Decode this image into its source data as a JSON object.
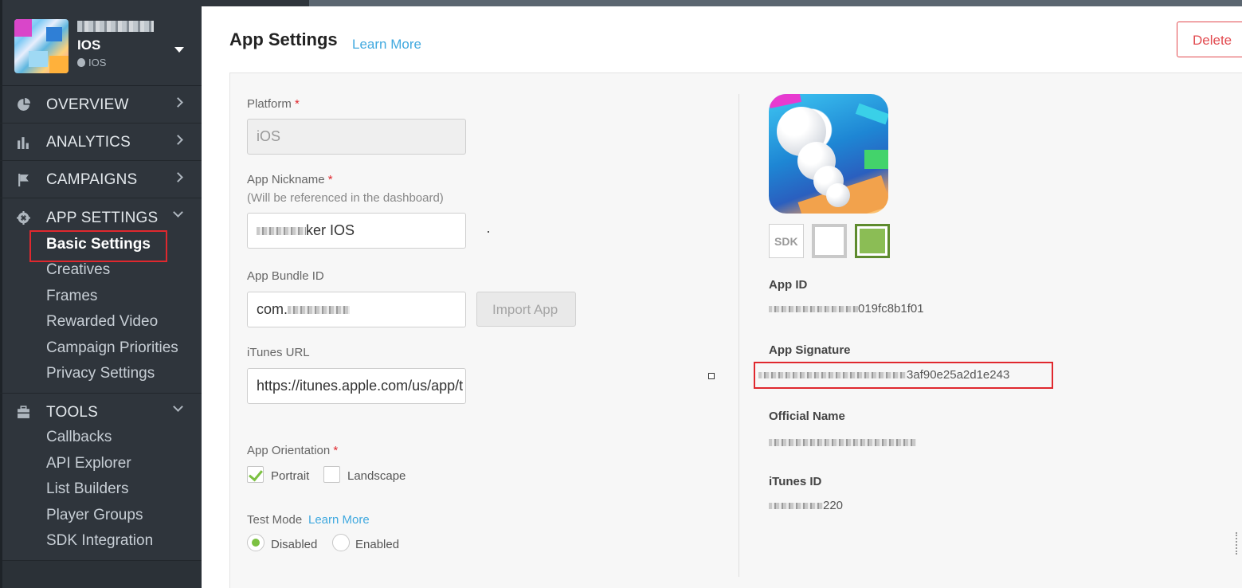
{
  "sidebar": {
    "app_name": "IOS",
    "app_platform": "IOS",
    "nav": [
      {
        "label": "OVERVIEW",
        "icon": "pie-chart-icon"
      },
      {
        "label": "ANALYTICS",
        "icon": "bar-chart-icon"
      },
      {
        "label": "CAMPAIGNS",
        "icon": "flag-icon"
      },
      {
        "label": "APP SETTINGS",
        "icon": "gear-icon"
      }
    ],
    "app_settings_items": [
      "Basic Settings",
      "Creatives",
      "Frames",
      "Rewarded Video",
      "Campaign Priorities",
      "Privacy Settings"
    ],
    "tools": {
      "label": "TOOLS",
      "icon": "toolbox-icon"
    },
    "tools_items": [
      "Callbacks",
      "API Explorer",
      "List Builders",
      "Player Groups",
      "SDK Integration"
    ]
  },
  "header": {
    "title": "App Settings",
    "learn_more": "Learn More",
    "delete_label": "Delete"
  },
  "form": {
    "platform_label": "Platform",
    "platform_value": "iOS",
    "nickname_label": "App Nickname",
    "nickname_note": "(Will be referenced in the dashboard)",
    "nickname_value_suffix": "ker IOS",
    "bundle_label": "App Bundle ID",
    "bundle_value_prefix": "com.",
    "import_label": "Import App",
    "itunes_label": "iTunes URL",
    "itunes_value": "https://itunes.apple.com/us/app/t",
    "orientation_label": "App Orientation",
    "portrait_label": "Portrait",
    "landscape_label": "Landscape",
    "portrait_checked": true,
    "landscape_checked": false,
    "test_mode_label": "Test Mode",
    "test_mode_learn_more": "Learn More",
    "disabled_label": "Disabled",
    "enabled_label": "Enabled",
    "test_mode_selected": "Disabled",
    "required_marker": "*"
  },
  "details": {
    "sdk_badge": "SDK",
    "app_id_label": "App ID",
    "app_id_value_suffix": "019fc8b1f01",
    "app_signature_label": "App Signature",
    "app_signature_value_suffix": "3af90e25a2d1e243",
    "official_name_label": "Official Name",
    "itunes_id_label": "iTunes ID",
    "itunes_id_value_suffix": "220"
  },
  "colors": {
    "sidebar_bg": "#2f353c",
    "accent_link": "#41a9df",
    "danger": "#e24a4f",
    "highlight_red": "#e0282e",
    "check_green": "#7cc142"
  }
}
